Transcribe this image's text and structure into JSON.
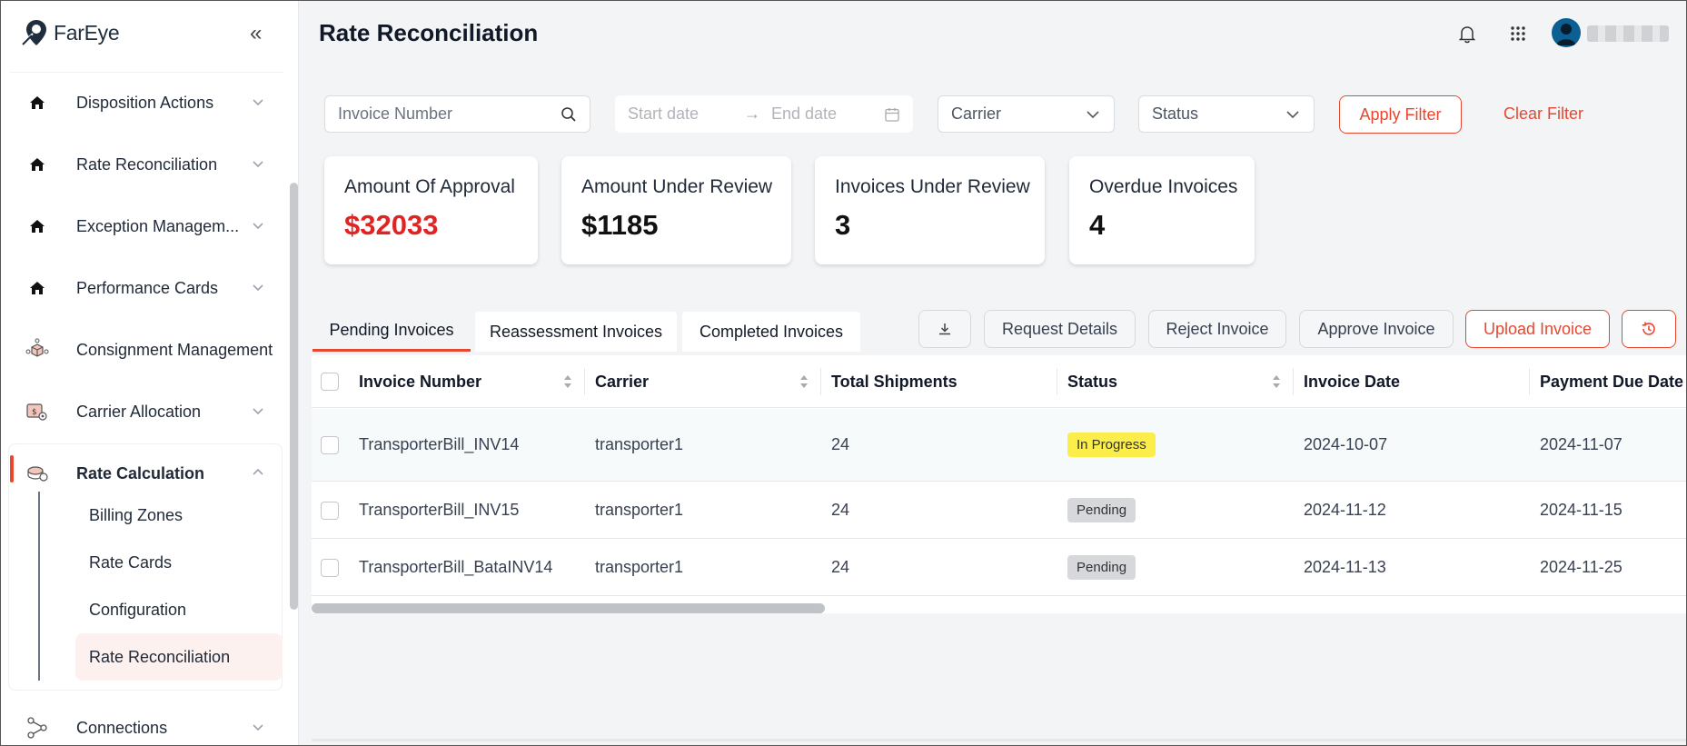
{
  "app": {
    "logo_text": "FarEye"
  },
  "header": {
    "title": "Rate Reconciliation"
  },
  "sidebar": {
    "items": [
      {
        "label": "Disposition Actions",
        "icon": "home-icon"
      },
      {
        "label": "Rate Reconciliation",
        "icon": "home-icon"
      },
      {
        "label": "Exception Managem...",
        "icon": "home-icon"
      },
      {
        "label": "Performance Cards",
        "icon": "home-icon"
      },
      {
        "label": "Consignment Management",
        "icon": "box-network-icon"
      },
      {
        "label": "Carrier Allocation",
        "icon": "carrier-settings-icon"
      },
      {
        "label": "Rate Calculation",
        "icon": "coins-icon"
      },
      {
        "label": "Connections",
        "icon": "connections-icon"
      }
    ],
    "sub_items": [
      "Billing Zones",
      "Rate Cards",
      "Configuration",
      "Rate Reconciliation"
    ]
  },
  "filters": {
    "invoice_placeholder": "Invoice Number",
    "start_date_placeholder": "Start date",
    "end_date_placeholder": "End date",
    "carrier_placeholder": "Carrier",
    "status_placeholder": "Status",
    "apply_label": "Apply Filter",
    "clear_label": "Clear Filter"
  },
  "stats": [
    {
      "label": "Amount Of Approval",
      "value": "$32033"
    },
    {
      "label": "Amount Under Review",
      "value": "$1185"
    },
    {
      "label": "Invoices Under Review",
      "value": "3"
    },
    {
      "label": "Overdue Invoices",
      "value": "4"
    }
  ],
  "tabs": [
    "Pending Invoices",
    "Reassessment Invoices",
    "Completed Invoices"
  ],
  "actions": {
    "request_details": "Request Details",
    "reject_invoice": "Reject Invoice",
    "approve_invoice": "Approve Invoice",
    "upload_invoice": "Upload Invoice"
  },
  "table": {
    "columns": [
      "Invoice Number",
      "Carrier",
      "Total Shipments",
      "Status",
      "Invoice Date",
      "Payment Due Date"
    ],
    "rows": [
      {
        "invoice": "TransporterBill_INV14",
        "carrier": "transporter1",
        "shipments": "24",
        "status": "In Progress",
        "invoice_date": "2024-10-07",
        "due_date": "2024-11-07"
      },
      {
        "invoice": "TransporterBill_INV15",
        "carrier": "transporter1",
        "shipments": "24",
        "status": "Pending",
        "invoice_date": "2024-11-12",
        "due_date": "2024-11-15"
      },
      {
        "invoice": "TransporterBill_BataINV14",
        "carrier": "transporter1",
        "shipments": "24",
        "status": "Pending",
        "invoice_date": "2024-11-13",
        "due_date": "2024-11-25"
      }
    ]
  },
  "colors": {
    "accent": "#e8472f",
    "value_red": "#e02424",
    "in_progress": "#fcee4a",
    "pending": "#d6d8dc"
  }
}
